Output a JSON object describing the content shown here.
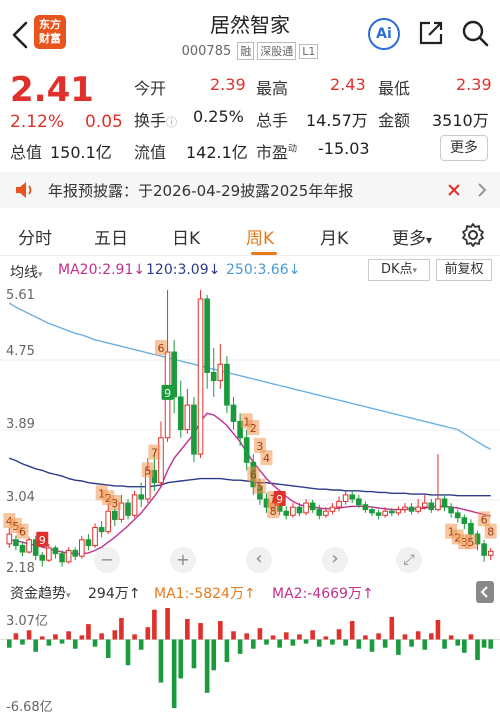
{
  "header": {
    "back_icon": "chevron-left-icon",
    "logo_line1": "东方",
    "logo_line2": "财富",
    "stock_name": "居然智家",
    "stock_code": "000785",
    "tag_rong": "融",
    "tag_sgt": "深股通",
    "tag_level": "L1",
    "ai_label": "Ai",
    "share_icon": "share-icon",
    "search_icon": "search-icon"
  },
  "quote": {
    "price": "2.41",
    "change_pct": "2.12%",
    "change_amt": "0.05",
    "open_label": "今开",
    "open": "2.39",
    "high_label": "最高",
    "high": "2.43",
    "low_label": "最低",
    "low": "2.39",
    "turnover_label": "换手",
    "turnover": "0.25%",
    "volume_label": "总手",
    "volume": "14.57万",
    "amount_label": "金额",
    "amount": "3510万",
    "mktcap_label": "总值",
    "mktcap": "150.1亿",
    "float_label": "流值",
    "float": "142.1亿",
    "pe_label": "市盈",
    "pe_sup": "动",
    "pe": "-15.03",
    "more": "更多"
  },
  "notice": {
    "speaker_icon": "speaker-icon",
    "text": "年报预披露：于2026-04-29披露2025年年报",
    "close_icon": "close-icon"
  },
  "tabs": [
    {
      "label": "分时",
      "active": false
    },
    {
      "label": "五日",
      "active": false
    },
    {
      "label": "日K",
      "active": false
    },
    {
      "label": "周K",
      "active": true
    },
    {
      "label": "月K",
      "active": false
    },
    {
      "label": "更多",
      "active": false
    }
  ],
  "tab_more_arrow": "▾",
  "ma_bar": {
    "selector": "均线",
    "ma20": "MA20:2.91↓",
    "ma120": "120:3.09↓",
    "ma250": "250:3.66↓",
    "dk_label": "DK点",
    "fq_label": "前复权"
  },
  "price_axis": [
    "5.61",
    "4.75",
    "3.89",
    "3.04",
    "2.18"
  ],
  "chart_controls": [
    "−",
    "+",
    "‹",
    "›",
    "⤢"
  ],
  "fund_bar": {
    "label": "资金趋势",
    "value": "294万↑",
    "ma1": "MA1:-5824万↑",
    "ma2": "MA2:-4669万↑"
  },
  "fund_axis": [
    "3.07亿",
    "-6.68亿"
  ],
  "colors": {
    "up": "#e0302b",
    "down": "#1a9a3c",
    "accent": "#e87a1e",
    "ma20": "#c0308f",
    "ma120": "#2b3a8c",
    "ma250": "#6ab0e0"
  },
  "chart_data": {
    "type": "candlestick",
    "title": "",
    "ylim": [
      2.18,
      5.61
    ],
    "candles": [
      [
        2.5,
        2.62,
        2.45,
        2.7
      ],
      [
        2.55,
        2.48,
        2.42,
        2.6
      ],
      [
        2.48,
        2.4,
        2.35,
        2.52
      ],
      [
        2.4,
        2.55,
        2.38,
        2.58
      ],
      [
        2.55,
        2.36,
        2.3,
        2.6
      ],
      [
        2.36,
        2.3,
        2.22,
        2.4
      ],
      [
        2.3,
        2.45,
        2.28,
        2.5
      ],
      [
        2.45,
        2.38,
        2.32,
        2.48
      ],
      [
        2.38,
        2.28,
        2.22,
        2.42
      ],
      [
        2.28,
        2.42,
        2.26,
        2.46
      ],
      [
        2.42,
        2.35,
        2.3,
        2.46
      ],
      [
        2.35,
        2.55,
        2.32,
        2.6
      ],
      [
        2.55,
        2.48,
        2.42,
        2.62
      ],
      [
        2.48,
        2.7,
        2.45,
        2.75
      ],
      [
        2.7,
        2.65,
        2.58,
        2.78
      ],
      [
        2.65,
        2.9,
        2.62,
        3.0
      ],
      [
        2.9,
        2.8,
        2.72,
        2.95
      ],
      [
        2.8,
        3.0,
        2.76,
        3.1
      ],
      [
        3.0,
        2.85,
        2.8,
        3.05
      ],
      [
        2.85,
        3.1,
        2.82,
        3.15
      ],
      [
        3.1,
        3.05,
        2.95,
        3.25
      ],
      [
        3.05,
        3.4,
        3.0,
        3.55
      ],
      [
        3.4,
        3.25,
        3.15,
        3.6
      ],
      [
        3.25,
        3.8,
        3.2,
        4.0
      ],
      [
        3.8,
        4.85,
        3.75,
        5.61
      ],
      [
        4.85,
        4.3,
        4.1,
        5.0
      ],
      [
        4.3,
        3.9,
        3.8,
        4.5
      ],
      [
        3.9,
        4.2,
        3.85,
        4.4
      ],
      [
        4.2,
        3.6,
        3.5,
        4.3
      ],
      [
        3.6,
        5.5,
        3.55,
        5.61
      ],
      [
        5.5,
        4.6,
        4.4,
        5.55
      ],
      [
        4.6,
        4.5,
        4.3,
        4.9
      ],
      [
        4.5,
        4.7,
        4.4,
        4.95
      ],
      [
        4.7,
        4.2,
        4.1,
        4.8
      ],
      [
        4.2,
        4.0,
        3.9,
        4.3
      ],
      [
        4.0,
        3.8,
        3.7,
        4.1
      ],
      [
        3.8,
        3.5,
        3.4,
        3.9
      ],
      [
        3.5,
        3.2,
        3.1,
        3.6
      ],
      [
        3.2,
        3.05,
        2.98,
        3.3
      ],
      [
        3.05,
        2.95,
        2.88,
        3.12
      ],
      [
        2.95,
        3.0,
        2.9,
        3.08
      ],
      [
        3.0,
        2.9,
        2.85,
        3.05
      ],
      [
        2.9,
        2.85,
        2.8,
        2.96
      ],
      [
        2.85,
        2.95,
        2.82,
        3.0
      ],
      [
        2.95,
        2.88,
        2.84,
        3.0
      ],
      [
        2.88,
        3.0,
        2.85,
        3.05
      ],
      [
        3.0,
        2.92,
        2.88,
        3.04
      ],
      [
        2.92,
        2.85,
        2.8,
        2.98
      ],
      [
        2.85,
        2.9,
        2.82,
        2.95
      ],
      [
        2.9,
        2.95,
        2.86,
        3.0
      ],
      [
        2.95,
        3.02,
        2.9,
        3.08
      ],
      [
        3.02,
        3.1,
        2.98,
        3.15
      ],
      [
        3.1,
        3.05,
        3.0,
        3.15
      ],
      [
        3.05,
        2.98,
        2.94,
        3.1
      ],
      [
        2.98,
        2.92,
        2.88,
        3.02
      ],
      [
        2.92,
        2.88,
        2.84,
        2.96
      ],
      [
        2.88,
        2.85,
        2.8,
        2.92
      ],
      [
        2.85,
        2.9,
        2.82,
        2.95
      ],
      [
        2.9,
        2.88,
        2.84,
        2.94
      ],
      [
        2.88,
        2.92,
        2.85,
        2.96
      ],
      [
        2.92,
        2.95,
        2.88,
        3.0
      ],
      [
        2.95,
        2.9,
        2.86,
        3.0
      ],
      [
        2.9,
        2.95,
        2.87,
        3.05
      ],
      [
        2.95,
        3.0,
        2.92,
        3.1
      ],
      [
        3.0,
        2.92,
        2.88,
        3.05
      ],
      [
        2.92,
        3.05,
        2.9,
        3.6
      ],
      [
        3.05,
        2.95,
        2.9,
        3.1
      ],
      [
        2.95,
        2.88,
        2.82,
        3.0
      ],
      [
        2.88,
        2.82,
        2.76,
        2.92
      ],
      [
        2.82,
        2.75,
        2.68,
        2.86
      ],
      [
        2.75,
        2.62,
        2.55,
        2.8
      ],
      [
        2.62,
        2.5,
        2.42,
        2.66
      ],
      [
        2.5,
        2.36,
        2.28,
        2.55
      ],
      [
        2.36,
        2.41,
        2.3,
        2.45
      ]
    ],
    "ma20": [
      2.55,
      2.54,
      2.52,
      2.5,
      2.48,
      2.46,
      2.44,
      2.42,
      2.4,
      2.39,
      2.38,
      2.38,
      2.39,
      2.42,
      2.46,
      2.52,
      2.58,
      2.65,
      2.72,
      2.8,
      2.88,
      2.98,
      3.08,
      3.2,
      3.4,
      3.55,
      3.65,
      3.75,
      3.85,
      4.0,
      4.1,
      4.08,
      4.02,
      3.95,
      3.85,
      3.75,
      3.62,
      3.5,
      3.4,
      3.3,
      3.22,
      3.15,
      3.08,
      3.02,
      2.98,
      2.96,
      2.95,
      2.94,
      2.93,
      2.93,
      2.94,
      2.95,
      2.96,
      2.96,
      2.96,
      2.95,
      2.94,
      2.93,
      2.92,
      2.92,
      2.92,
      2.93,
      2.93,
      2.94,
      2.95,
      2.96,
      2.96,
      2.95,
      2.94,
      2.92,
      2.9,
      2.88,
      2.86,
      2.84
    ],
    "ma120": [
      3.55,
      3.52,
      3.48,
      3.45,
      3.42,
      3.4,
      3.37,
      3.35,
      3.33,
      3.3,
      3.28,
      3.27,
      3.25,
      3.24,
      3.23,
      3.22,
      3.21,
      3.21,
      3.2,
      3.2,
      3.2,
      3.2,
      3.21,
      3.22,
      3.25,
      3.26,
      3.27,
      3.28,
      3.29,
      3.3,
      3.3,
      3.3,
      3.3,
      3.29,
      3.28,
      3.28,
      3.27,
      3.26,
      3.25,
      3.25,
      3.24,
      3.23,
      3.22,
      3.21,
      3.2,
      3.19,
      3.18,
      3.17,
      3.17,
      3.16,
      3.16,
      3.15,
      3.15,
      3.15,
      3.14,
      3.14,
      3.13,
      3.13,
      3.12,
      3.12,
      3.12,
      3.11,
      3.11,
      3.11,
      3.1,
      3.1,
      3.1,
      3.1,
      3.09,
      3.09,
      3.09,
      3.09,
      3.09,
      3.09
    ],
    "ma250": [
      5.45,
      5.4,
      5.36,
      5.32,
      5.28,
      5.24,
      5.2,
      5.17,
      5.14,
      5.11,
      5.08,
      5.06,
      5.03,
      5.0,
      4.98,
      4.96,
      4.94,
      4.92,
      4.9,
      4.88,
      4.86,
      4.84,
      4.82,
      4.8,
      4.78,
      4.76,
      4.74,
      4.72,
      4.7,
      4.68,
      4.66,
      4.64,
      4.62,
      4.6,
      4.58,
      4.56,
      4.54,
      4.52,
      4.5,
      4.48,
      4.46,
      4.44,
      4.42,
      4.4,
      4.38,
      4.36,
      4.34,
      4.32,
      4.3,
      4.28,
      4.26,
      4.24,
      4.22,
      4.2,
      4.18,
      4.16,
      4.14,
      4.12,
      4.1,
      4.08,
      4.06,
      4.04,
      4.02,
      4.0,
      3.98,
      3.96,
      3.94,
      3.92,
      3.9,
      3.85,
      3.8,
      3.75,
      3.7,
      3.66
    ],
    "marker_labels": [
      {
        "i": 0,
        "text": "4",
        "y": 2.78,
        "kind": "orange"
      },
      {
        "i": 1,
        "text": "5",
        "y": 2.72,
        "kind": "orange"
      },
      {
        "i": 2,
        "text": "6",
        "y": 2.65,
        "kind": "orange"
      },
      {
        "i": 5,
        "text": "9",
        "y": 2.55,
        "kind": "red"
      },
      {
        "i": 14,
        "text": "1",
        "y": 3.12,
        "kind": "orange"
      },
      {
        "i": 15,
        "text": "2",
        "y": 3.06,
        "kind": "orange"
      },
      {
        "i": 16,
        "text": "3",
        "y": 3.0,
        "kind": "orange"
      },
      {
        "i": 21,
        "text": "5",
        "y": 3.4,
        "kind": "orange"
      },
      {
        "i": 22,
        "text": "7",
        "y": 3.62,
        "kind": "orange"
      },
      {
        "i": 23,
        "text": "6",
        "y": 4.9,
        "kind": "orange"
      },
      {
        "i": 24,
        "text": "9",
        "y": 4.35,
        "kind": "greenbox"
      },
      {
        "i": 36,
        "text": "1",
        "y": 4.0,
        "kind": "orange"
      },
      {
        "i": 37,
        "text": "2",
        "y": 3.92,
        "kind": "orange"
      },
      {
        "i": 38,
        "text": "3",
        "y": 3.7,
        "kind": "orange"
      },
      {
        "i": 39,
        "text": "4",
        "y": 3.55,
        "kind": "orange"
      },
      {
        "i": 37,
        "text": "6",
        "y": 3.35,
        "kind": "orange"
      },
      {
        "i": 38,
        "text": "5",
        "y": 3.2,
        "kind": "orange"
      },
      {
        "i": 40,
        "text": "7",
        "y": 3.05,
        "kind": "orange"
      },
      {
        "i": 41,
        "text": "9",
        "y": 3.05,
        "kind": "red"
      },
      {
        "i": 40,
        "text": "8",
        "y": 2.9,
        "kind": "orange"
      },
      {
        "i": 67,
        "text": "1",
        "y": 2.65,
        "kind": "orange"
      },
      {
        "i": 68,
        "text": "2",
        "y": 2.58,
        "kind": "orange"
      },
      {
        "i": 69,
        "text": "3",
        "y": 2.52,
        "kind": "orange"
      },
      {
        "i": 70,
        "text": "5",
        "y": 2.52,
        "kind": "orange"
      },
      {
        "i": 72,
        "text": "6",
        "y": 2.8,
        "kind": "orange"
      },
      {
        "i": 73,
        "text": "8",
        "y": 2.65,
        "kind": "orange"
      }
    ],
    "fund_flow": [
      -0.8,
      0.6,
      -0.5,
      0.9,
      -1.2,
      0.3,
      -0.6,
      0.5,
      -0.4,
      0.8,
      -0.9,
      0.4,
      1.5,
      -0.7,
      0.6,
      -1.8,
      0.9,
      2.1,
      -2.5,
      0.5,
      -1.0,
      1.2,
      2.9,
      -4.2,
      3.07,
      -6.68,
      -3.8,
      2.0,
      -2.8,
      1.6,
      -5.2,
      -3.0,
      1.8,
      -2.2,
      0.8,
      -1.4,
      0.6,
      -0.9,
      1.1,
      -0.5,
      0.4,
      -0.8,
      0.7,
      -0.6,
      0.5,
      -0.4,
      0.9,
      -0.7,
      0.3,
      -0.5,
      1.0,
      -0.6,
      1.8,
      -0.9,
      0.4,
      -1.2,
      0.6,
      -0.8,
      2.2,
      -1.5,
      0.5,
      -0.7,
      0.8,
      -1.0,
      0.6,
      1.9,
      -0.9,
      0.4,
      -0.6,
      -1.3,
      0.5,
      -2.0,
      -0.8,
      -0.9
    ],
    "fund_ylim": [
      -6.68,
      3.07
    ]
  }
}
